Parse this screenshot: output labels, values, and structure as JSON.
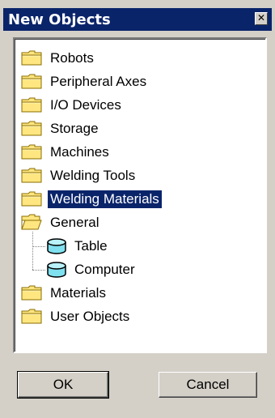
{
  "window": {
    "title": "New Objects",
    "close_glyph": "✕",
    "close_icon": "close-icon"
  },
  "tree": {
    "items": [
      {
        "label": "Robots",
        "icon": "folder-closed-icon",
        "level": 0,
        "selected": false
      },
      {
        "label": "Peripheral Axes",
        "icon": "folder-closed-icon",
        "level": 0,
        "selected": false
      },
      {
        "label": "I/O Devices",
        "icon": "folder-closed-icon",
        "level": 0,
        "selected": false
      },
      {
        "label": "Storage",
        "icon": "folder-closed-icon",
        "level": 0,
        "selected": false
      },
      {
        "label": "Machines",
        "icon": "folder-closed-icon",
        "level": 0,
        "selected": false
      },
      {
        "label": "Welding Tools",
        "icon": "folder-closed-icon",
        "level": 0,
        "selected": false
      },
      {
        "label": "Welding Materials",
        "icon": "folder-closed-icon",
        "level": 0,
        "selected": true
      },
      {
        "label": "General",
        "icon": "folder-open-icon",
        "level": 0,
        "selected": false
      },
      {
        "label": "Table",
        "icon": "cylinder-object-icon",
        "level": 1,
        "selected": false
      },
      {
        "label": "Computer",
        "icon": "cylinder-object-icon",
        "level": 1,
        "selected": false
      },
      {
        "label": "Materials",
        "icon": "folder-closed-icon",
        "level": 0,
        "selected": false
      },
      {
        "label": "User Objects",
        "icon": "folder-closed-icon",
        "level": 0,
        "selected": false
      }
    ]
  },
  "buttons": {
    "ok_label": "OK",
    "cancel_label": "Cancel"
  },
  "colors": {
    "titlebar": "#0a246a",
    "selection": "#0a246a",
    "folder": "#ffe680",
    "object": "#7fe0ef",
    "face": "#d4d0c8"
  }
}
